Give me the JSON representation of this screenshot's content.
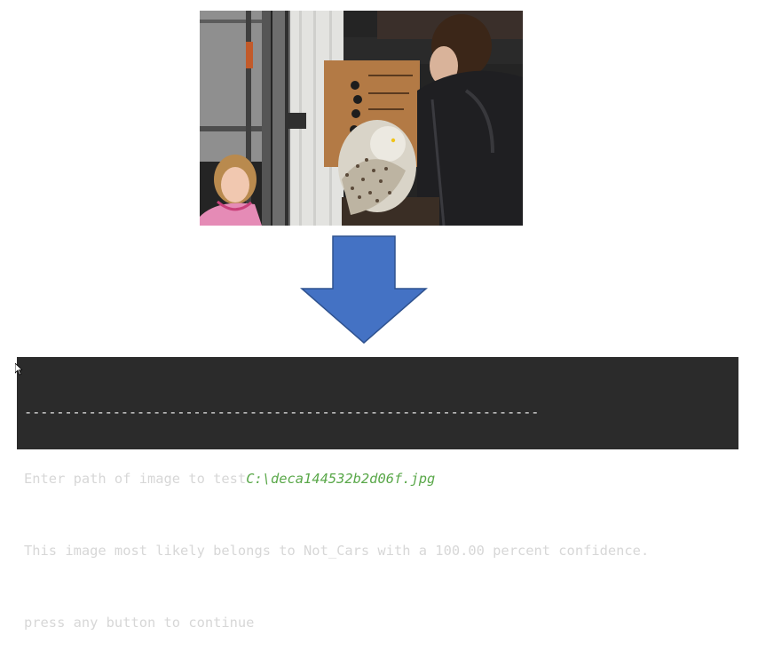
{
  "photo": {
    "subject": "snowy-owl-photo"
  },
  "terminal": {
    "separator": "----------------------------------------------------------------",
    "prompt_label": "Enter path of image to test",
    "input_value": "C:\\deca144532b2d06f.jpg",
    "result_line": "This image most likely belongs to Not_Cars with a 100.00 percent confidence.",
    "continue_line": "press any button to continue"
  },
  "colors": {
    "terminal_bg": "#2b2b2b",
    "terminal_text": "#d7d7d7",
    "input_text": "#5aa84a",
    "arrow_fill": "#4472c4",
    "arrow_stroke": "#2f528f"
  },
  "icons": [
    "down-arrow-icon",
    "mouse-cursor-icon"
  ]
}
